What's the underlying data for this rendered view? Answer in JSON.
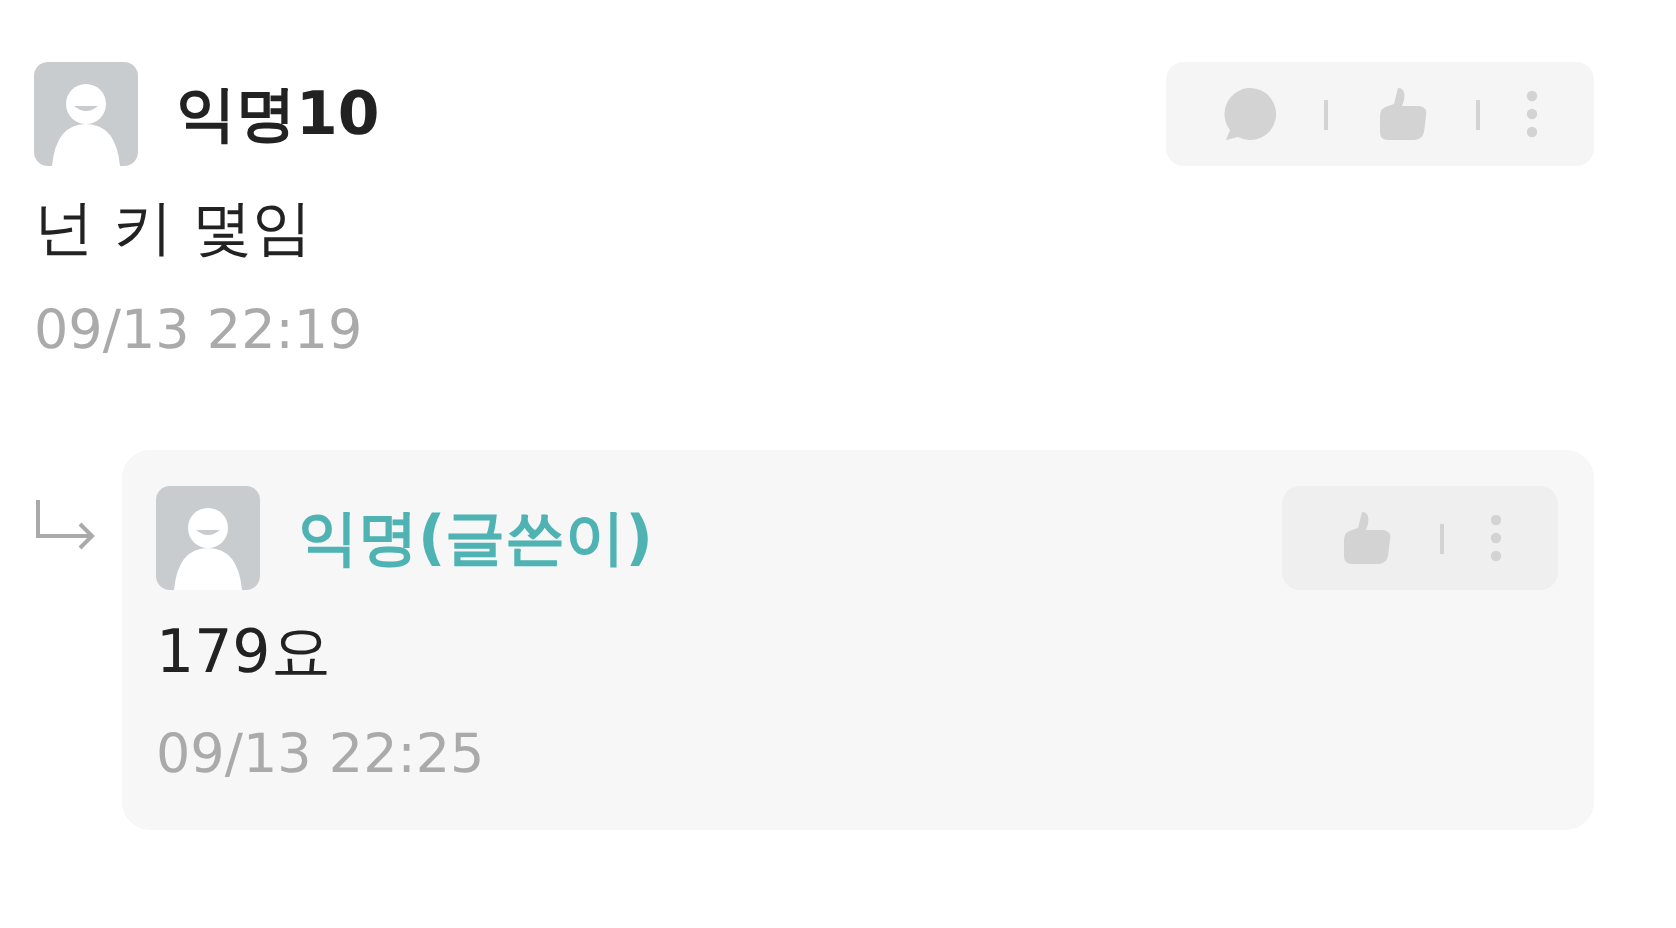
{
  "comments": [
    {
      "author": "익명10",
      "is_author": false,
      "text": "넌 키 몇임",
      "time": "09/13 22:19",
      "actions": [
        {
          "kind": "reply"
        },
        {
          "kind": "like"
        },
        {
          "kind": "more"
        }
      ],
      "replies": [
        {
          "author": "익명(글쓴이)",
          "is_author": true,
          "text": "179요",
          "time": "09/13 22:25",
          "actions": [
            {
              "kind": "like"
            },
            {
              "kind": "more"
            }
          ]
        }
      ]
    }
  ]
}
